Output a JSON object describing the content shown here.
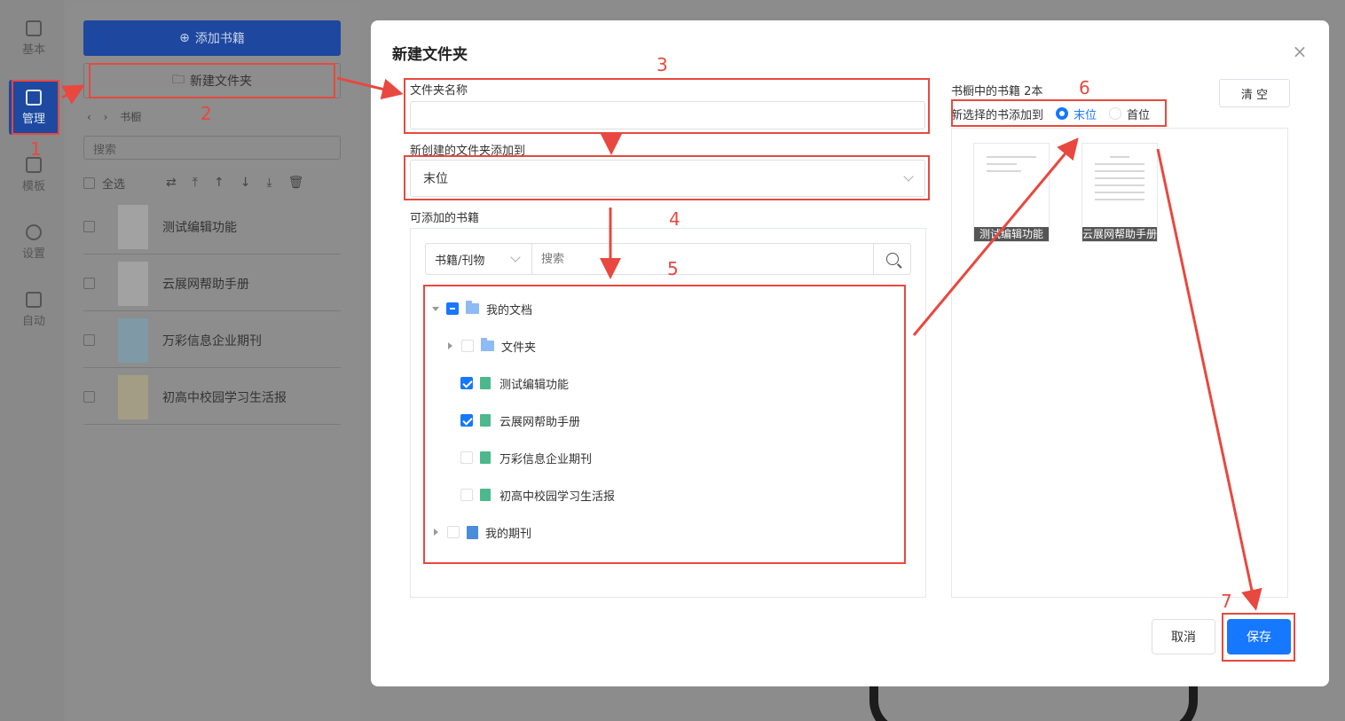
{
  "app_nav": {
    "items": [
      {
        "label": "基本",
        "icon": "document-icon"
      },
      {
        "label": "管理",
        "icon": "books-icon",
        "active": true
      },
      {
        "label": "模板",
        "icon": "template-icon"
      },
      {
        "label": "设置",
        "icon": "gear-icon"
      },
      {
        "label": "自动",
        "icon": "folder-sync-icon"
      }
    ]
  },
  "panel": {
    "add_book_label": "添加书籍",
    "new_folder_label": "新建文件夹",
    "breadcrumb": "书橱",
    "search_placeholder": "搜索",
    "select_all_label": "全选",
    "books": [
      {
        "title": "测试编辑功能"
      },
      {
        "title": "云展网帮助手册"
      },
      {
        "title": "万彩信息企业期刊"
      },
      {
        "title": "初高中校园学习生活报"
      }
    ]
  },
  "modal": {
    "title": "新建文件夹",
    "folder_name_label": "文件夹名称",
    "folder_name_value": "",
    "add_to_label": "新创建的文件夹添加到",
    "add_to_value": "末位",
    "available_label": "可添加的书籍",
    "filter_type": "书籍/刊物",
    "filter_placeholder": "搜索",
    "tree": {
      "root": {
        "label": "我的文档",
        "state": "indeterminate"
      },
      "subfolder": {
        "label": "文件夹",
        "state": "unchecked"
      },
      "books": [
        {
          "label": "测试编辑功能",
          "state": "checked"
        },
        {
          "label": "云展网帮助手册",
          "state": "checked"
        },
        {
          "label": "万彩信息企业期刊",
          "state": "unchecked"
        },
        {
          "label": "初高中校园学习生活报",
          "state": "unchecked"
        }
      ],
      "journals": {
        "label": "我的期刊",
        "state": "unchecked"
      }
    },
    "shelf_label": "书橱中的书籍",
    "shelf_count": "2本",
    "clear_label": "清 空",
    "new_books_position_label": "新选择的书添加到",
    "position_options": [
      "末位",
      "首位"
    ],
    "position_selected": "末位",
    "shelf_books": [
      "测试编辑功能",
      "云展网帮助手册"
    ],
    "cancel_label": "取消",
    "save_label": "保存"
  },
  "annotations": [
    "1",
    "2",
    "3",
    "4",
    "5",
    "6",
    "7"
  ],
  "colors": {
    "accent": "#1677ff",
    "annotation": "#e8483f",
    "nav_active": "#1d4aa0"
  }
}
